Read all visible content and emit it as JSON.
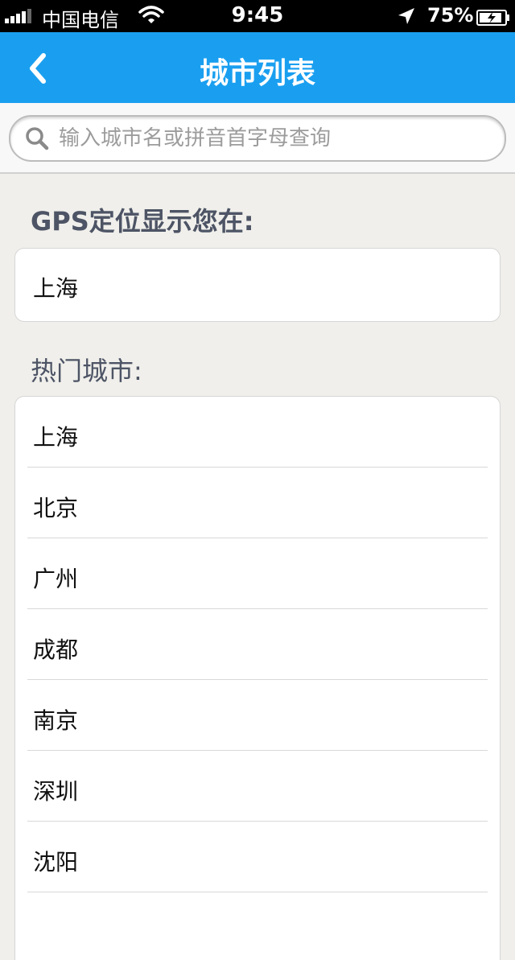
{
  "status_bar": {
    "carrier": "中国电信",
    "time": "9:45",
    "battery": "75%"
  },
  "nav": {
    "title": "城市列表"
  },
  "search": {
    "placeholder": "输入城市名或拼音首字母查询"
  },
  "gps": {
    "label": "GPS定位显示您在:",
    "city": "上海"
  },
  "hot": {
    "label": "热门城市:",
    "cities": [
      "上海",
      "北京",
      "广州",
      "成都",
      "南京",
      "深圳",
      "沈阳"
    ]
  },
  "colors": {
    "nav_bg": "#1a9ff0",
    "page_bg": "#f0efeb",
    "label_text": "#4d5465"
  },
  "icons": [
    "back-chevron-icon",
    "search-icon",
    "wifi-icon",
    "location-arrow-icon",
    "battery-icon",
    "signal-icon"
  ]
}
